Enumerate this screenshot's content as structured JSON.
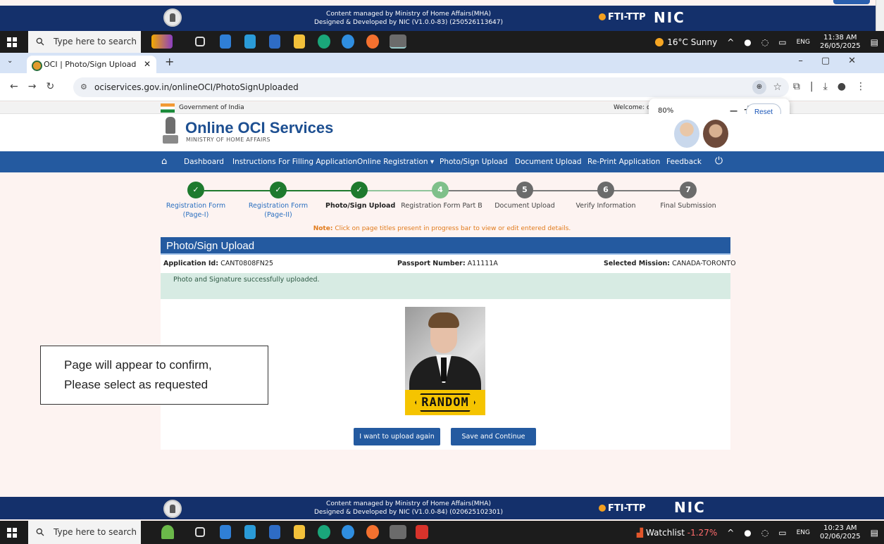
{
  "site_footer_top": {
    "line1": "Content managed by Ministry of Home Affairs(MHA)",
    "line2": "Designed & Developed by NIC (V1.0.0-83) (250526113647)",
    "ftt_logo": "FTI-TTP",
    "nic_logo": "NIC"
  },
  "taskbar_top": {
    "search_placeholder": "Type here to search",
    "weather": "16°C  Sunny",
    "lang": "ENG",
    "time": "11:38 AM",
    "date": "26/05/2025"
  },
  "browser": {
    "tab_title": "OCI | Photo/Sign Upload",
    "url": "ociservices.gov.in/onlineOCI/PhotoSignUploaded",
    "zoom_level": "80%",
    "zoom_reset": "Reset"
  },
  "gov_strip": {
    "text": "Government of India",
    "welcome": "Welcome: o"
  },
  "header": {
    "title": "Online OCI Services",
    "subtitle": "MINISTRY OF HOME AFFAIRS"
  },
  "nav": {
    "items": [
      "Dashboard",
      "Instructions For Filling Application",
      "Online Registration ▾",
      "Photo/Sign Upload",
      "Document Upload",
      "Re-Print Application",
      "Feedback"
    ]
  },
  "steps": [
    {
      "mark": "✓",
      "label": "Registration Form",
      "label2": "(Page-I)",
      "state": "done"
    },
    {
      "mark": "✓",
      "label": "Registration Form",
      "label2": "(Page-II)",
      "state": "done"
    },
    {
      "mark": "✓",
      "label": "Photo/Sign Upload",
      "label2": "",
      "state": "current"
    },
    {
      "mark": "4",
      "label": "Registration Form Part B",
      "label2": "",
      "state": "next"
    },
    {
      "mark": "5",
      "label": "Document Upload",
      "label2": "",
      "state": "pending"
    },
    {
      "mark": "6",
      "label": "Verify Information",
      "label2": "",
      "state": "pending"
    },
    {
      "mark": "7",
      "label": "Final Submission",
      "label2": "",
      "state": "pending"
    }
  ],
  "note": {
    "prefix": "Note:",
    "text": " Click on page titles present in progress bar to view or edit entered details."
  },
  "panel": {
    "title": "Photo/Sign Upload",
    "application_id_label": "Application Id:",
    "application_id": "CANT0808FN25",
    "passport_label": "Passport Number:",
    "passport": "A11111A",
    "mission_label": "Selected Mission:",
    "mission": "CANADA-TORONTO",
    "success_msg": "Photo and Signature successfully uploaded.",
    "signature_text": "RANDOM",
    "upload_again": "I want to upload again",
    "save_continue": "Save and Continue"
  },
  "callout": {
    "line1": "Page will appear to confirm,",
    "line2": "Please select as requested"
  },
  "site_footer_bottom": {
    "line1": "Content managed by Ministry of Home Affairs(MHA)",
    "line2": "Designed & Developed by NIC (V1.0.0-84) (020625102301)",
    "ftt_logo": "FTI-TTP",
    "nic_logo": "NIC"
  },
  "taskbar_bottom": {
    "search_placeholder": "Type here to search",
    "watchlist": "Watchlist",
    "watchlist_change": "-1.27%",
    "lang": "ENG",
    "time": "10:23 AM",
    "date": "02/06/2025"
  },
  "colors": {
    "primary_blue": "#245aa0",
    "step_done": "#1e7a2e",
    "step_next": "#7fc08a",
    "step_pending": "#6b6b6b",
    "note_orange": "#e17a1a"
  }
}
